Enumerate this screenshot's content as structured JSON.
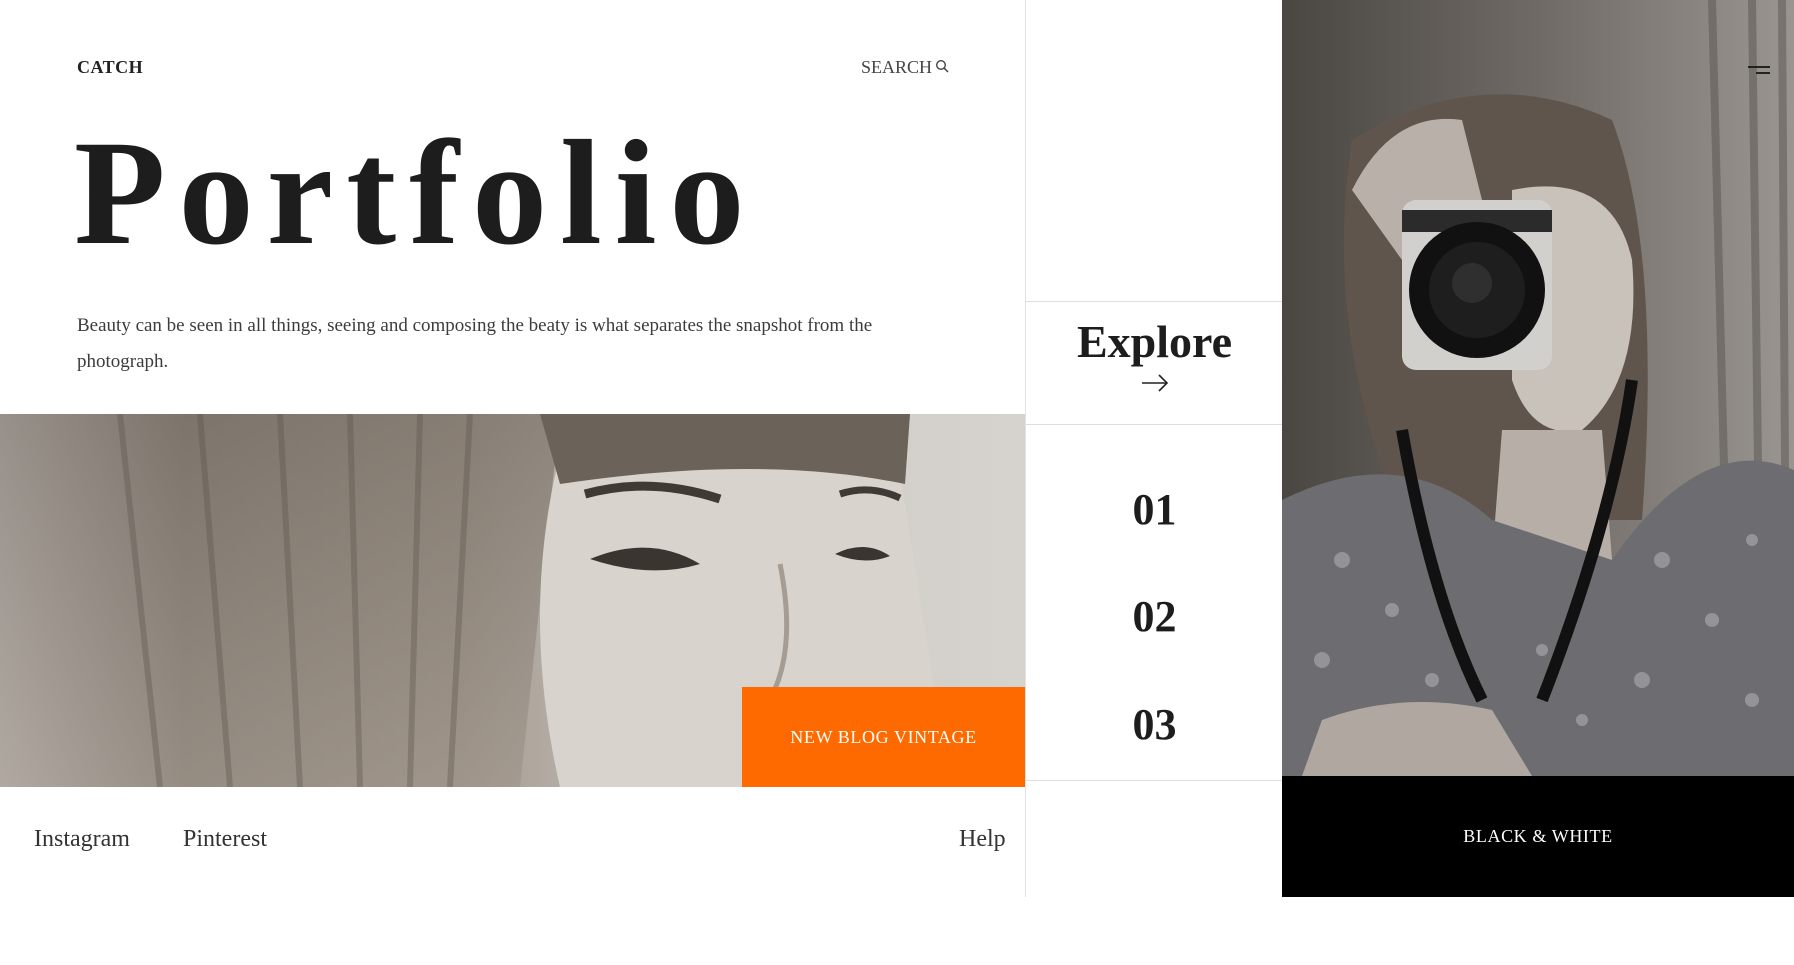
{
  "header": {
    "brand": "CATCH",
    "search_label": "SEARCH",
    "search_icon": "search-icon"
  },
  "hero": {
    "title": "Portfolio",
    "tagline": "Beauty can be seen in all things, seeing and composing the beaty is what separates the snapshot from the photograph.",
    "cta_label": "NEW BLOG VINTAGE"
  },
  "footer": {
    "links": [
      "Instagram",
      "Pinterest"
    ],
    "help": "Help"
  },
  "sidebar": {
    "explore_label": "Explore",
    "explore_icon": "arrow-right-icon",
    "numbers": [
      "01",
      "02",
      "03"
    ]
  },
  "feature": {
    "label": "BLACK & WHITE",
    "menu_icon": "menu-icon"
  },
  "colors": {
    "accent": "#ff6a00",
    "text": "#1d1d1d",
    "panel_dark": "#000000"
  }
}
